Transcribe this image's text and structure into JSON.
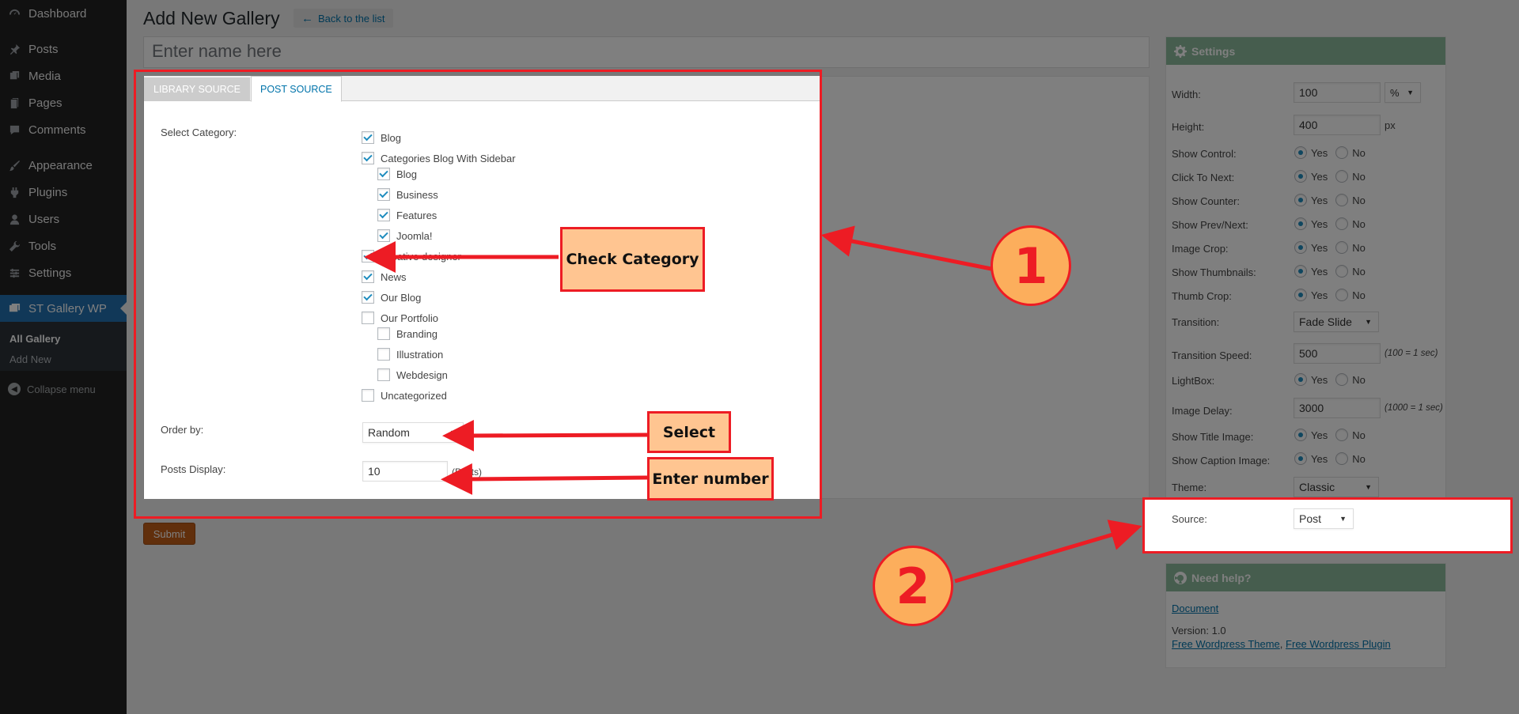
{
  "sidebar": {
    "items": [
      {
        "label": "Dashboard",
        "icon": "dashboard-icon"
      },
      {
        "label": "Posts",
        "icon": "pin-icon"
      },
      {
        "label": "Media",
        "icon": "media-icon"
      },
      {
        "label": "Pages",
        "icon": "pages-icon"
      },
      {
        "label": "Comments",
        "icon": "comment-icon"
      },
      {
        "label": "Appearance",
        "icon": "brush-icon"
      },
      {
        "label": "Plugins",
        "icon": "plugin-icon"
      },
      {
        "label": "Users",
        "icon": "user-icon"
      },
      {
        "label": "Tools",
        "icon": "wrench-icon"
      },
      {
        "label": "Settings",
        "icon": "sliders-icon"
      },
      {
        "label": "ST Gallery WP",
        "icon": "gallery-icon"
      }
    ],
    "submenu": [
      "All Gallery",
      "Add New"
    ],
    "collapse_label": "Collapse menu"
  },
  "page": {
    "title": "Add New Gallery",
    "back_label": "Back to the list",
    "name_placeholder": "Enter name here",
    "submit_label": "Submit"
  },
  "tabs": [
    "LIBRARY SOURCE",
    "POST SOURCE"
  ],
  "form": {
    "category_label": "Select Category:",
    "categories": [
      {
        "label": "Blog",
        "checked": true,
        "level": 0
      },
      {
        "label": "Categories Blog With Sidebar",
        "checked": true,
        "level": 0
      },
      {
        "label": "Blog",
        "checked": true,
        "level": 1
      },
      {
        "label": "Business",
        "checked": true,
        "level": 1
      },
      {
        "label": "Features",
        "checked": true,
        "level": 1
      },
      {
        "label": "Joomla!",
        "checked": true,
        "level": 1
      },
      {
        "label": "Creative designer",
        "checked": true,
        "level": 0
      },
      {
        "label": "News",
        "checked": true,
        "level": 0
      },
      {
        "label": "Our Blog",
        "checked": true,
        "level": 0
      },
      {
        "label": "Our Portfolio",
        "checked": false,
        "level": 0
      },
      {
        "label": "Branding",
        "checked": false,
        "level": 1
      },
      {
        "label": "Illustration",
        "checked": false,
        "level": 1
      },
      {
        "label": "Webdesign",
        "checked": false,
        "level": 1
      },
      {
        "label": "Uncategorized",
        "checked": false,
        "level": 0
      }
    ],
    "order_label": "Order by:",
    "order_value": "Random",
    "posts_label": "Posts Display:",
    "posts_value": "10",
    "posts_unit": "(Posts)"
  },
  "settings": {
    "title": "Settings",
    "width_label": "Width:",
    "width_value": "100",
    "width_unit": "%",
    "height_label": "Height:",
    "height_value": "400",
    "height_unit": "px",
    "yes": "Yes",
    "no": "No",
    "toggles": [
      {
        "label": "Show Control:",
        "value": "Yes"
      },
      {
        "label": "Click To Next:",
        "value": "Yes"
      },
      {
        "label": "Show Counter:",
        "value": "Yes"
      },
      {
        "label": "Show Prev/Next:",
        "value": "Yes"
      },
      {
        "label": "Image Crop:",
        "value": "Yes"
      },
      {
        "label": "Show Thumbnails:",
        "value": "Yes"
      },
      {
        "label": "Thumb Crop:",
        "value": "Yes"
      }
    ],
    "transition_label": "Transition:",
    "transition_value": "Fade Slide",
    "speed_label": "Transition Speed:",
    "speed_value": "500",
    "speed_hint": "(100 = 1 sec)",
    "lightbox_label": "LightBox:",
    "delay_label": "Image Delay:",
    "delay_value": "3000",
    "delay_hint": "(1000 = 1 sec)",
    "title_image_label": "Show Title Image:",
    "caption_image_label": "Show Caption Image:",
    "theme_label": "Theme:",
    "theme_value": "Classic",
    "source_label": "Source:",
    "source_value": "Post"
  },
  "help": {
    "title": "Need help?",
    "document_link": "Document",
    "version": "Version: 1.0",
    "link1": "Free Wordpress Theme",
    "separator": ",",
    "link2": "Free Wordpress Plugin"
  },
  "annotations": {
    "check_category": "Check Category",
    "select": "Select",
    "enter_number": "Enter number",
    "num1": "1",
    "num2": "2",
    "accent": "#ed1c24",
    "callout_fill": "#ffc591"
  }
}
